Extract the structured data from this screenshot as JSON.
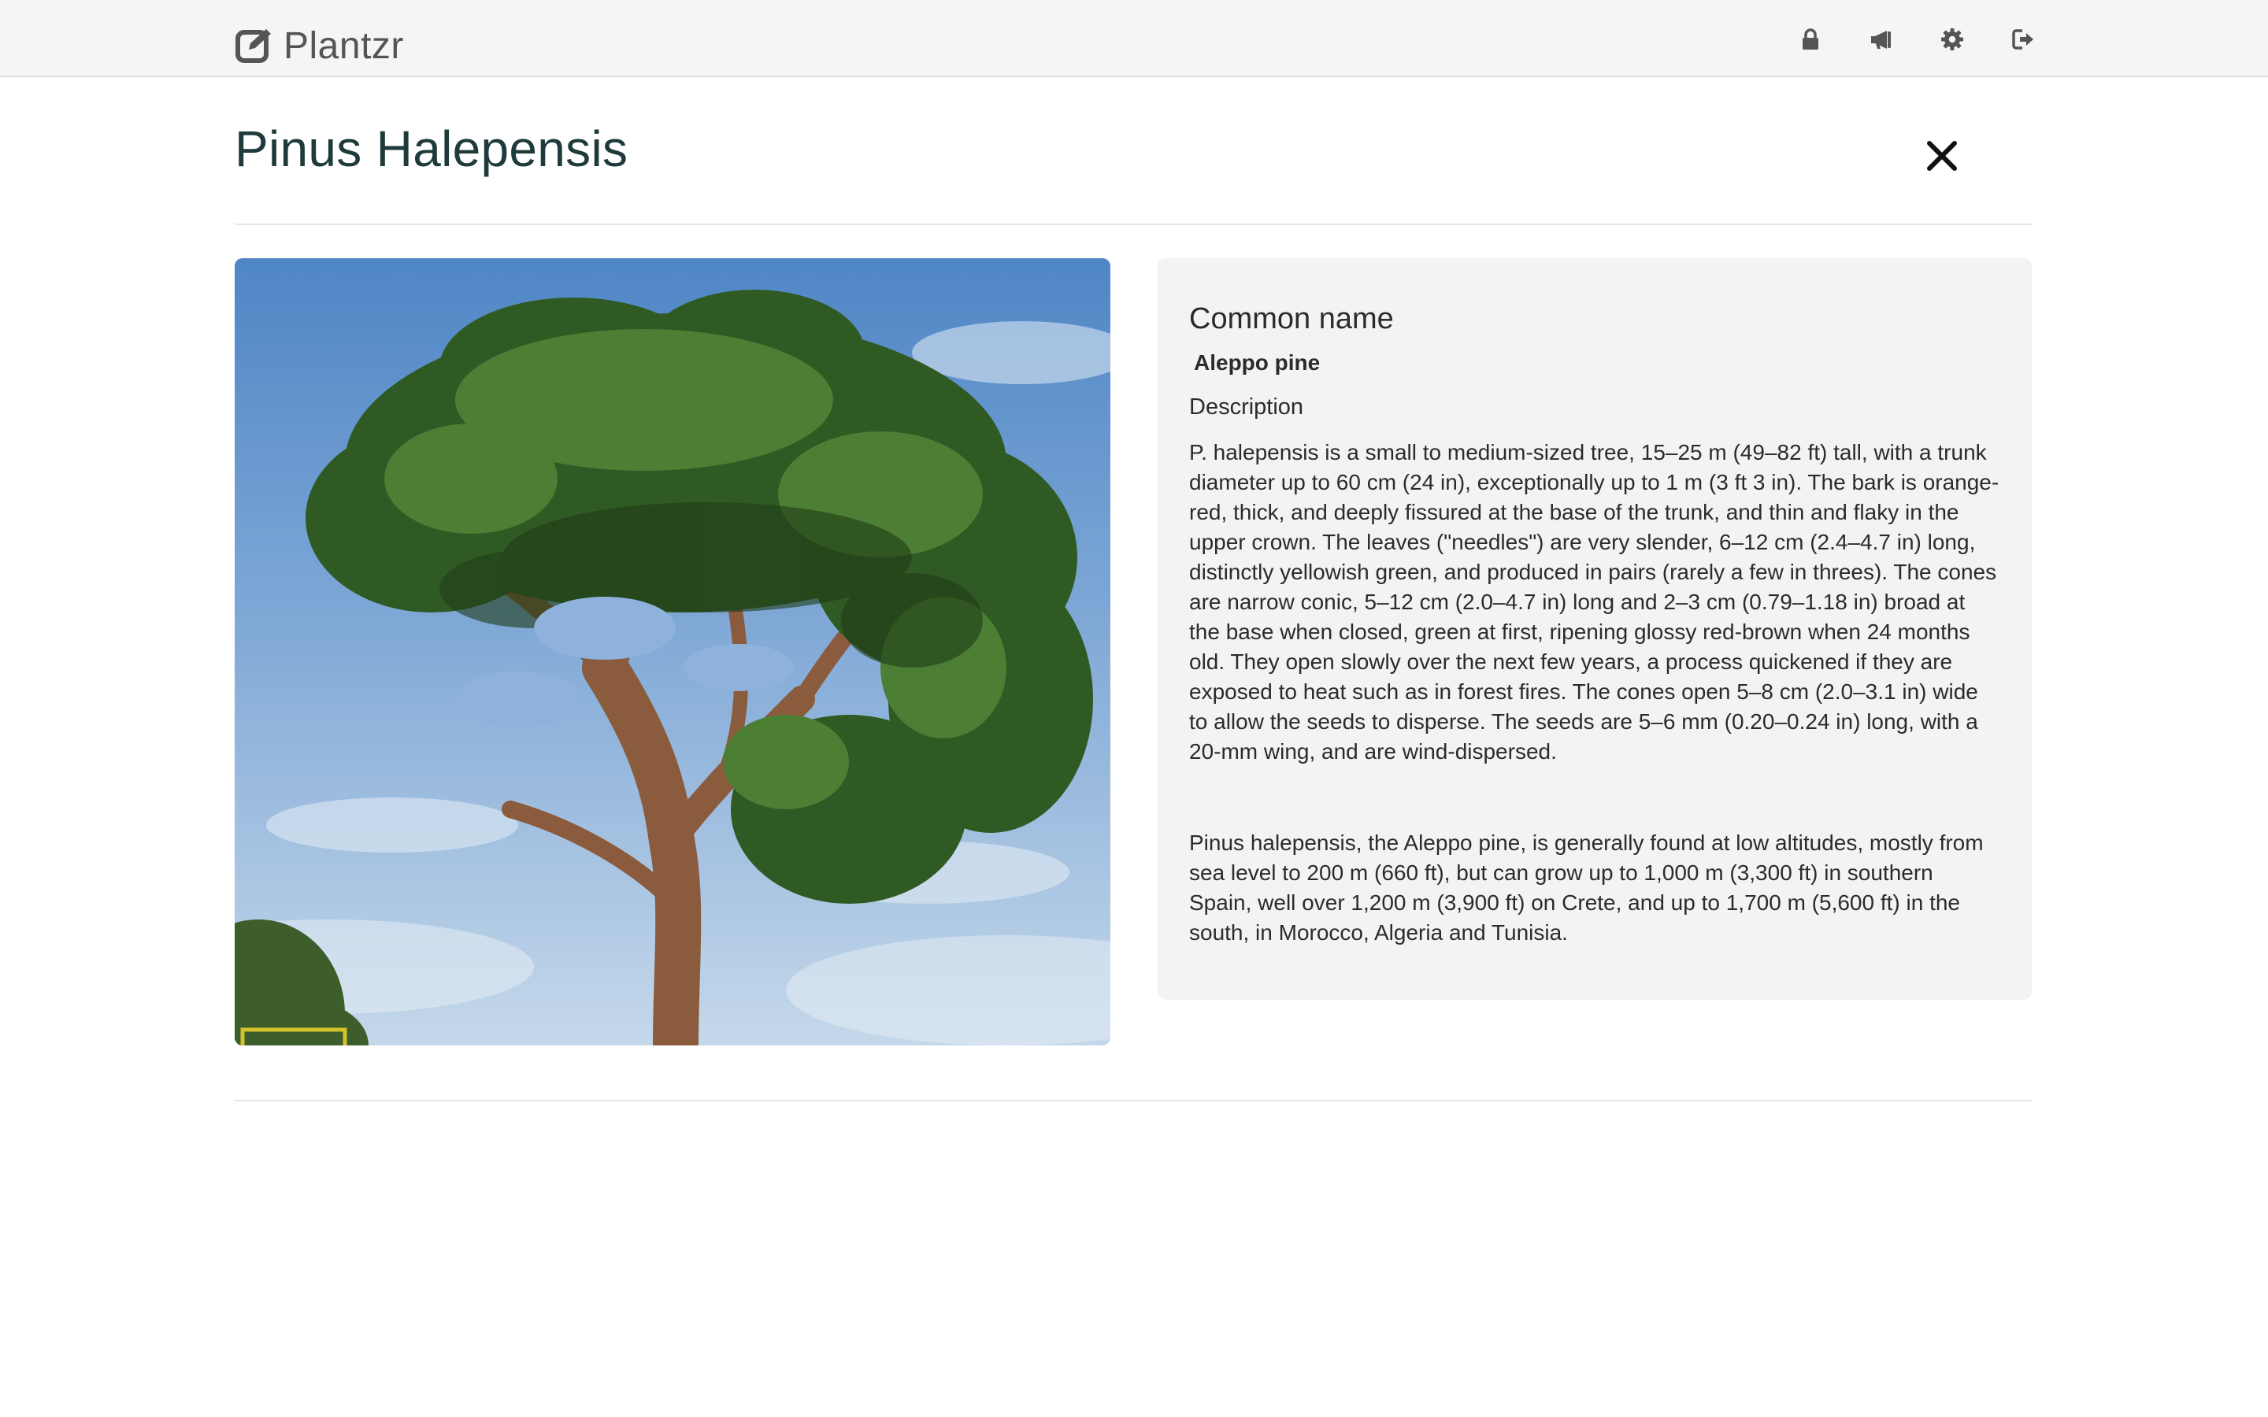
{
  "app": {
    "brand": "Plantzr"
  },
  "nav": {
    "icons": [
      "lock-icon",
      "megaphone-icon",
      "gear-icon",
      "sign-out-icon"
    ]
  },
  "plant": {
    "title": "Pinus Halepensis",
    "common_name_label": "Common name",
    "common_name": "Aleppo pine",
    "description_label": "Description",
    "description_1": "P. halepensis is a small to medium-sized tree, 15–25 m (49–82 ft) tall, with a trunk diameter up to 60 cm (24 in), exceptionally up to 1 m (3 ft 3 in). The bark is orange-red, thick, and deeply fissured at the base of the trunk, and thin and flaky in the upper crown. The leaves (\"needles\") are very slender, 6–12 cm (2.4–4.7 in) long, distinctly yellowish green, and produced in pairs (rarely a few in threes). The cones are narrow conic, 5–12 cm (2.0–4.7 in) long and 2–3 cm (0.79–1.18 in) broad at the base when closed, green at first, ripening glossy red-brown when 24 months old. They open slowly over the next few years, a process quickened if they are exposed to heat such as in forest fires. The cones open 5–8 cm (2.0–3.1 in) wide to allow the seeds to disperse. The seeds are 5–6 mm (0.20–0.24 in) long, with a 20-mm wing, and are wind-dispersed.",
    "description_2": "Pinus halepensis, the Aleppo pine, is generally found at low altitudes, mostly from sea level to 200 m (660 ft), but can grow up to 1,000 m (3,300 ft) in southern Spain, well over 1,200 m (3,900 ft) on Crete, and up to 1,700 m (5,600 ft) in the south, in Morocco, Algeria and Tunisia."
  },
  "colors": {
    "title": "#1e3a3a",
    "navbar_bg": "#f5f5f5",
    "panel_bg": "#f3f3f3"
  }
}
